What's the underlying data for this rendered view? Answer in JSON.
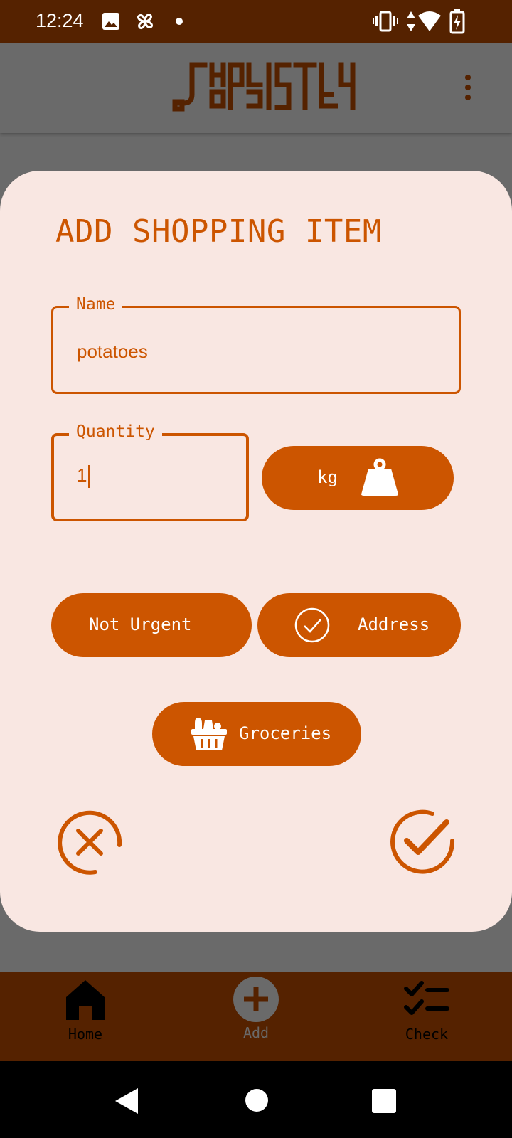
{
  "status_bar": {
    "time": "12:24",
    "icons": [
      "image-icon",
      "pinwheel-icon",
      "dot-icon",
      "vibrate-icon",
      "data-arrows-icon",
      "wifi-icon",
      "battery-charging-icon"
    ]
  },
  "app_bar": {
    "logo_text": "SHOPPISTLY",
    "menu_icon": "more-vert-icon"
  },
  "dialog": {
    "title": "ADD SHOPPING ITEM",
    "name_field": {
      "label": "Name",
      "value": "potatoes"
    },
    "quantity_field": {
      "label": "Quantity",
      "value": "1"
    },
    "unit_button": {
      "label": "kg",
      "icon": "weight-icon"
    },
    "urgency_button": {
      "label": "Not Urgent"
    },
    "address_button": {
      "label": "Address",
      "icon": "check-circle-icon"
    },
    "category_button": {
      "label": "Groceries",
      "icon": "grocery-basket-icon"
    },
    "cancel_icon": "cancel-circle-icon",
    "confirm_icon": "confirm-check-icon"
  },
  "bottom_nav": {
    "items": [
      {
        "label": "Home",
        "icon": "home-icon"
      },
      {
        "label": "Add",
        "icon": "add-circle-icon"
      },
      {
        "label": "Check",
        "icon": "checklist-icon"
      }
    ]
  },
  "colors": {
    "accent": "#cc5500",
    "brand_dark": "#552200",
    "dialog_bg": "#f9e7e2",
    "scrim": "#6a6a6a"
  }
}
